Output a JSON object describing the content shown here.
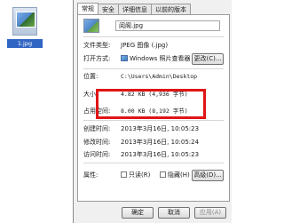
{
  "desktop": {
    "file_label": "1.jpg"
  },
  "dialog": {
    "tabs": [
      "常规",
      "安全",
      "详细信息",
      "以前的版本"
    ],
    "general": {
      "file_name": "阅阁.jpg",
      "type_label": "文件类型:",
      "type_value": "JPEG 图像 (.jpg)",
      "open_label": "打开方式:",
      "open_value": "Windows 照片查看器",
      "change_button": "更改(C)...",
      "location_label": "位置:",
      "location_value": "C:\\Users\\Admin\\Desktop",
      "size_label": "大小:",
      "size_value": "4.82 KB (4,936 字节)",
      "disk_label": "占用空间:",
      "disk_value": "8.00 KB (8,192 字节)",
      "created_label": "创建时间:",
      "created_value": "2013年3月16日, 10:05:23",
      "modified_label": "修改时间:",
      "modified_value": "2013年3月16日, 10:05:24",
      "accessed_label": "访问时间:",
      "accessed_value": "2013年3月16日, 10:05:23",
      "attributes_label": "属性:",
      "readonly_label": "只读(R)",
      "hidden_label": "隐藏(H)",
      "advanced_button": "高级(D)..."
    },
    "buttons": {
      "ok": "确定",
      "cancel": "取消",
      "apply": "应用(A)"
    },
    "highlight_color": "#e01414"
  }
}
